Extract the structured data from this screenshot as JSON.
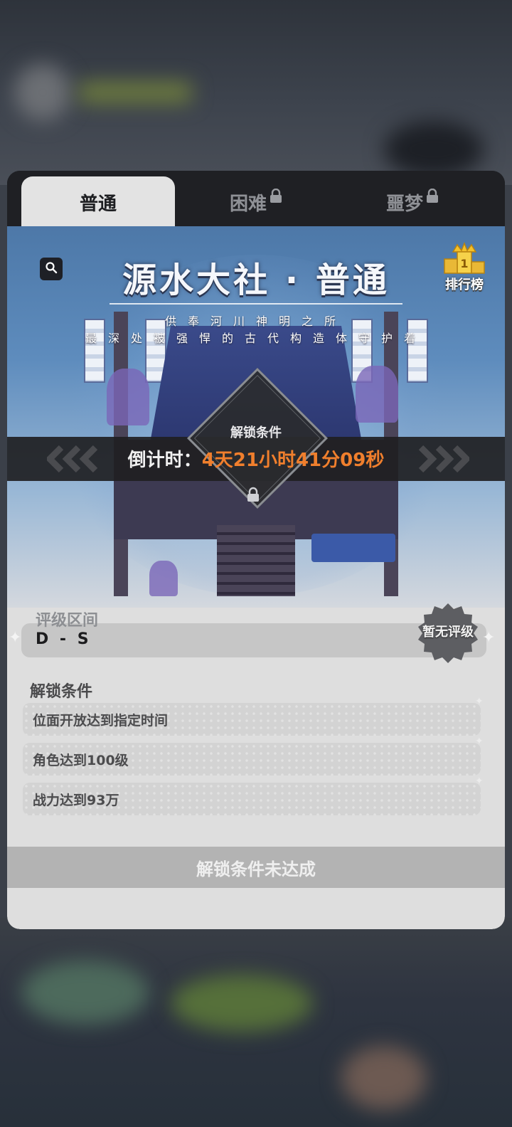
{
  "tabs": [
    {
      "label": "普通",
      "locked": false,
      "active": true
    },
    {
      "label": "困难",
      "locked": true,
      "active": false
    },
    {
      "label": "噩梦",
      "locked": true,
      "active": false
    }
  ],
  "banner": {
    "title": "源水大社 · 普通",
    "subtitle_line1": "供奉河川神明之所",
    "subtitle_line2": "最深处被强悍的古代构造体守护着",
    "ranking_label": "排行榜",
    "unlock_label": "解锁条件",
    "countdown_prefix": "倒计时：",
    "countdown_value": "4天21小时41分09秒"
  },
  "rating": {
    "label": "评级区间",
    "range": "D - S",
    "status": "暂无评级"
  },
  "conditions": {
    "title": "解锁条件",
    "items": [
      "位面开放达到指定时间",
      "角色达到100级",
      "战力达到93万"
    ]
  },
  "action_button": {
    "label": "解锁条件未达成",
    "enabled": false
  },
  "colors": {
    "accent_orange": "#f07f2d",
    "tab_active_bg": "#e3e3e3",
    "dialog_bg": "#1f2024",
    "content_bg": "#dedede"
  }
}
